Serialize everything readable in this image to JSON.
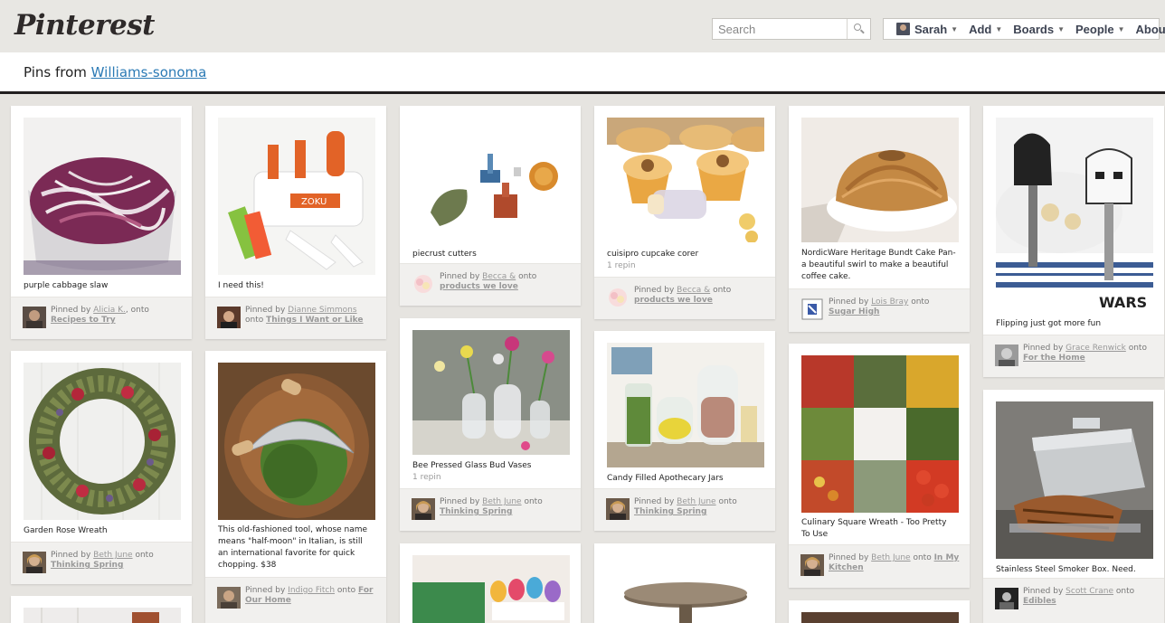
{
  "header": {
    "logo": "Pinterest",
    "search_placeholder": "Search",
    "nav": [
      {
        "label": "Sarah"
      },
      {
        "label": "Add"
      },
      {
        "label": "Boards"
      },
      {
        "label": "People"
      },
      {
        "label": "About"
      }
    ]
  },
  "board": {
    "prefix": "Pins from",
    "source": "Williams-sonoma"
  },
  "pins": [
    {
      "desc": "purple cabbage slaw",
      "repin": "",
      "by_label": "Pinned by",
      "user": "Alicia K.",
      "onto": "onto",
      "board": "Recipes to Try"
    },
    {
      "desc": "I need this!",
      "repin": "",
      "by_label": "Pinned by",
      "user": "Dianne Simmons",
      "onto": "onto",
      "board": "Things I Want or Like"
    },
    {
      "desc": "piecrust cutters",
      "repin": "",
      "by_label": "Pinned by",
      "user": "Becca &",
      "onto": "onto",
      "board": "products we love"
    },
    {
      "desc": "cuisipro cupcake corer",
      "repin": "1 repin",
      "by_label": "Pinned by",
      "user": "Becca &",
      "onto": "onto",
      "board": "products we love"
    },
    {
      "desc": "NordicWare Heritage Bundt Cake Pan- a beautiful swirl to make a beautiful coffee cake.",
      "repin": "",
      "by_label": "Pinned by",
      "user": "Lois Bray",
      "onto": "onto",
      "board": "Sugar High"
    },
    {
      "desc": "Flipping just got more fun",
      "repin": "",
      "by_label": "Pinned by",
      "user": "Grace Renwick",
      "onto": "onto",
      "board": "For the Home"
    },
    {
      "desc": "Garden Rose Wreath",
      "repin": "",
      "by_label": "Pinned by",
      "user": "Beth June",
      "onto": "onto",
      "board": "Thinking Spring"
    },
    {
      "desc": "This old-fashioned tool, whose name means \"half-moon\" in Italian, is still an international favorite for quick chopping. $38",
      "repin": "",
      "by_label": "Pinned by",
      "user": "Indigo Fitch",
      "onto": "onto",
      "board": "For Our Home"
    },
    {
      "desc": "Bee Pressed Glass Bud Vases",
      "repin": "1 repin",
      "by_label": "Pinned by",
      "user": "Beth June",
      "onto": "onto",
      "board": "Thinking Spring"
    },
    {
      "desc": "Candy Filled Apothecary Jars",
      "repin": "",
      "by_label": "Pinned by",
      "user": "Beth June",
      "onto": "onto",
      "board": "Thinking Spring"
    },
    {
      "desc": "Culinary Square Wreath - Too Pretty To Use",
      "repin": "",
      "by_label": "Pinned by",
      "user": "Beth June",
      "onto": "onto",
      "board": "In My Kitchen"
    },
    {
      "desc": "Stainless Steel Smoker Box. Need.",
      "repin": "",
      "by_label": "Pinned by",
      "user": "Scott Crane",
      "onto": "onto",
      "board": "Edibles"
    }
  ]
}
